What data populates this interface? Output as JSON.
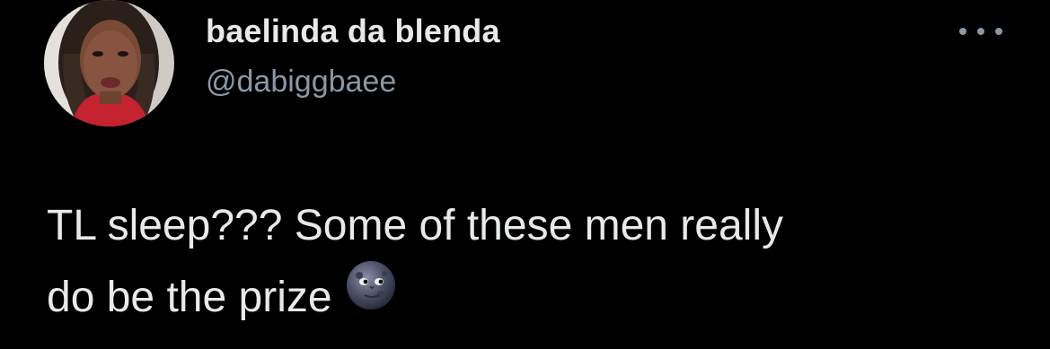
{
  "author": {
    "display_name": "baelinda da blenda",
    "handle": "@dabiggbaee",
    "avatar_icon": "profile-photo"
  },
  "menu": {
    "icon": "more-horizontal-icon"
  },
  "tweet": {
    "line1": "TL sleep??? Some of these men really",
    "line2": "do be the prize",
    "emoji": "new-moon-face-emoji"
  },
  "colors": {
    "background": "#000000",
    "primary_text": "#e7e9ea",
    "secondary_text": "#8b98a5"
  }
}
